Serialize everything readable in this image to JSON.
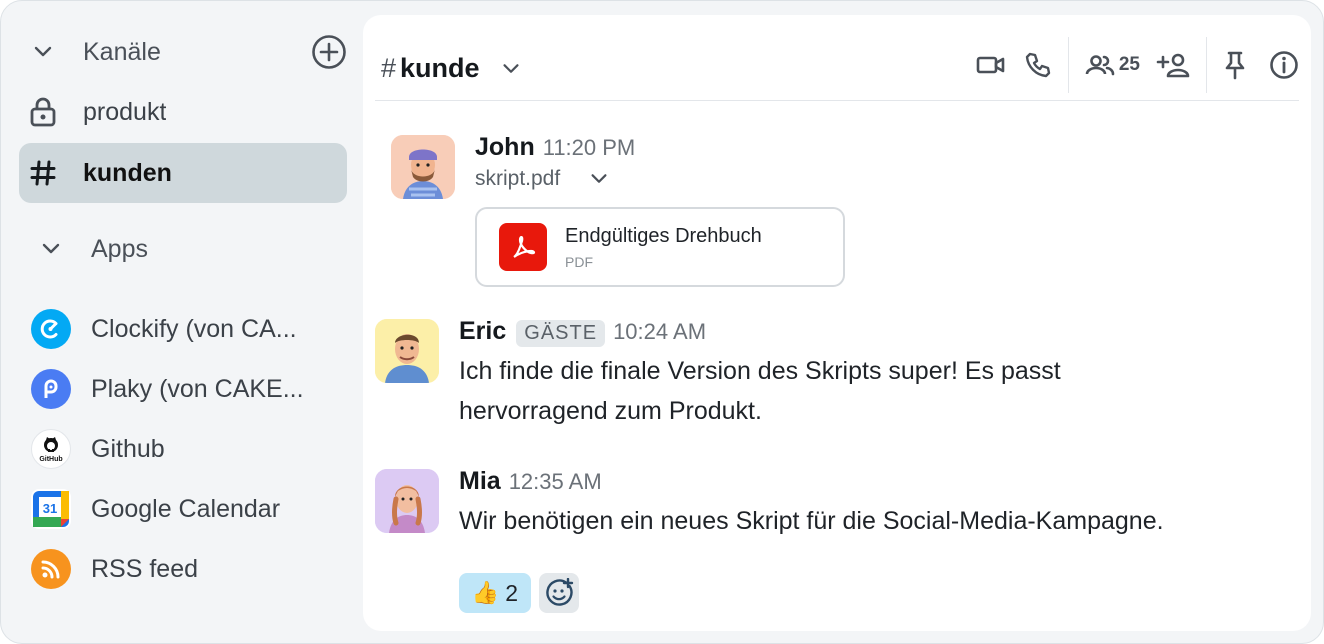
{
  "sidebar": {
    "channels_label": "Kanäle",
    "channels": [
      {
        "name": "produkt",
        "icon": "lock-icon",
        "active": false
      },
      {
        "name": "kunden",
        "icon": "hash-icon",
        "active": true
      }
    ],
    "apps_label": "Apps",
    "apps": [
      {
        "name": "Clockify (von CA...",
        "icon": "clockify-icon",
        "color": "#03a9f4"
      },
      {
        "name": "Plaky (von CAKE...",
        "icon": "plaky-icon",
        "color": "#4a7cf3"
      },
      {
        "name": "Github",
        "icon": "github-icon",
        "color": "#ffffff"
      },
      {
        "name": "Google Calendar",
        "icon": "google-calendar-icon",
        "color": "#1a73e8",
        "day": "31"
      },
      {
        "name": "RSS feed",
        "icon": "rss-icon",
        "color": "#f7931e"
      }
    ]
  },
  "header": {
    "channel_name": "kunde",
    "member_count": "25"
  },
  "messages": [
    {
      "author": "John",
      "time": "11:20 PM",
      "file_name": "skript.pdf",
      "attachment": {
        "title": "Endgültiges Drehbuch",
        "type": "PDF"
      }
    },
    {
      "author": "Eric",
      "badge": "GÄSTE",
      "time": "10:24 AM",
      "text_line1": "Ich finde die finale Version des Skripts super! Es passt",
      "text_line2": "hervorragend zum Produkt."
    },
    {
      "author": "Mia",
      "time": "12:35 AM",
      "text": "Wir benötigen ein neues Skript für die Social-Media-Kampagne.",
      "reaction": {
        "emoji": "👍",
        "count": "2"
      }
    }
  ],
  "colors": {
    "accent": "#cfd8dc",
    "reaction_bg": "#bfe6f8",
    "pdf_red": "#e8180c"
  }
}
